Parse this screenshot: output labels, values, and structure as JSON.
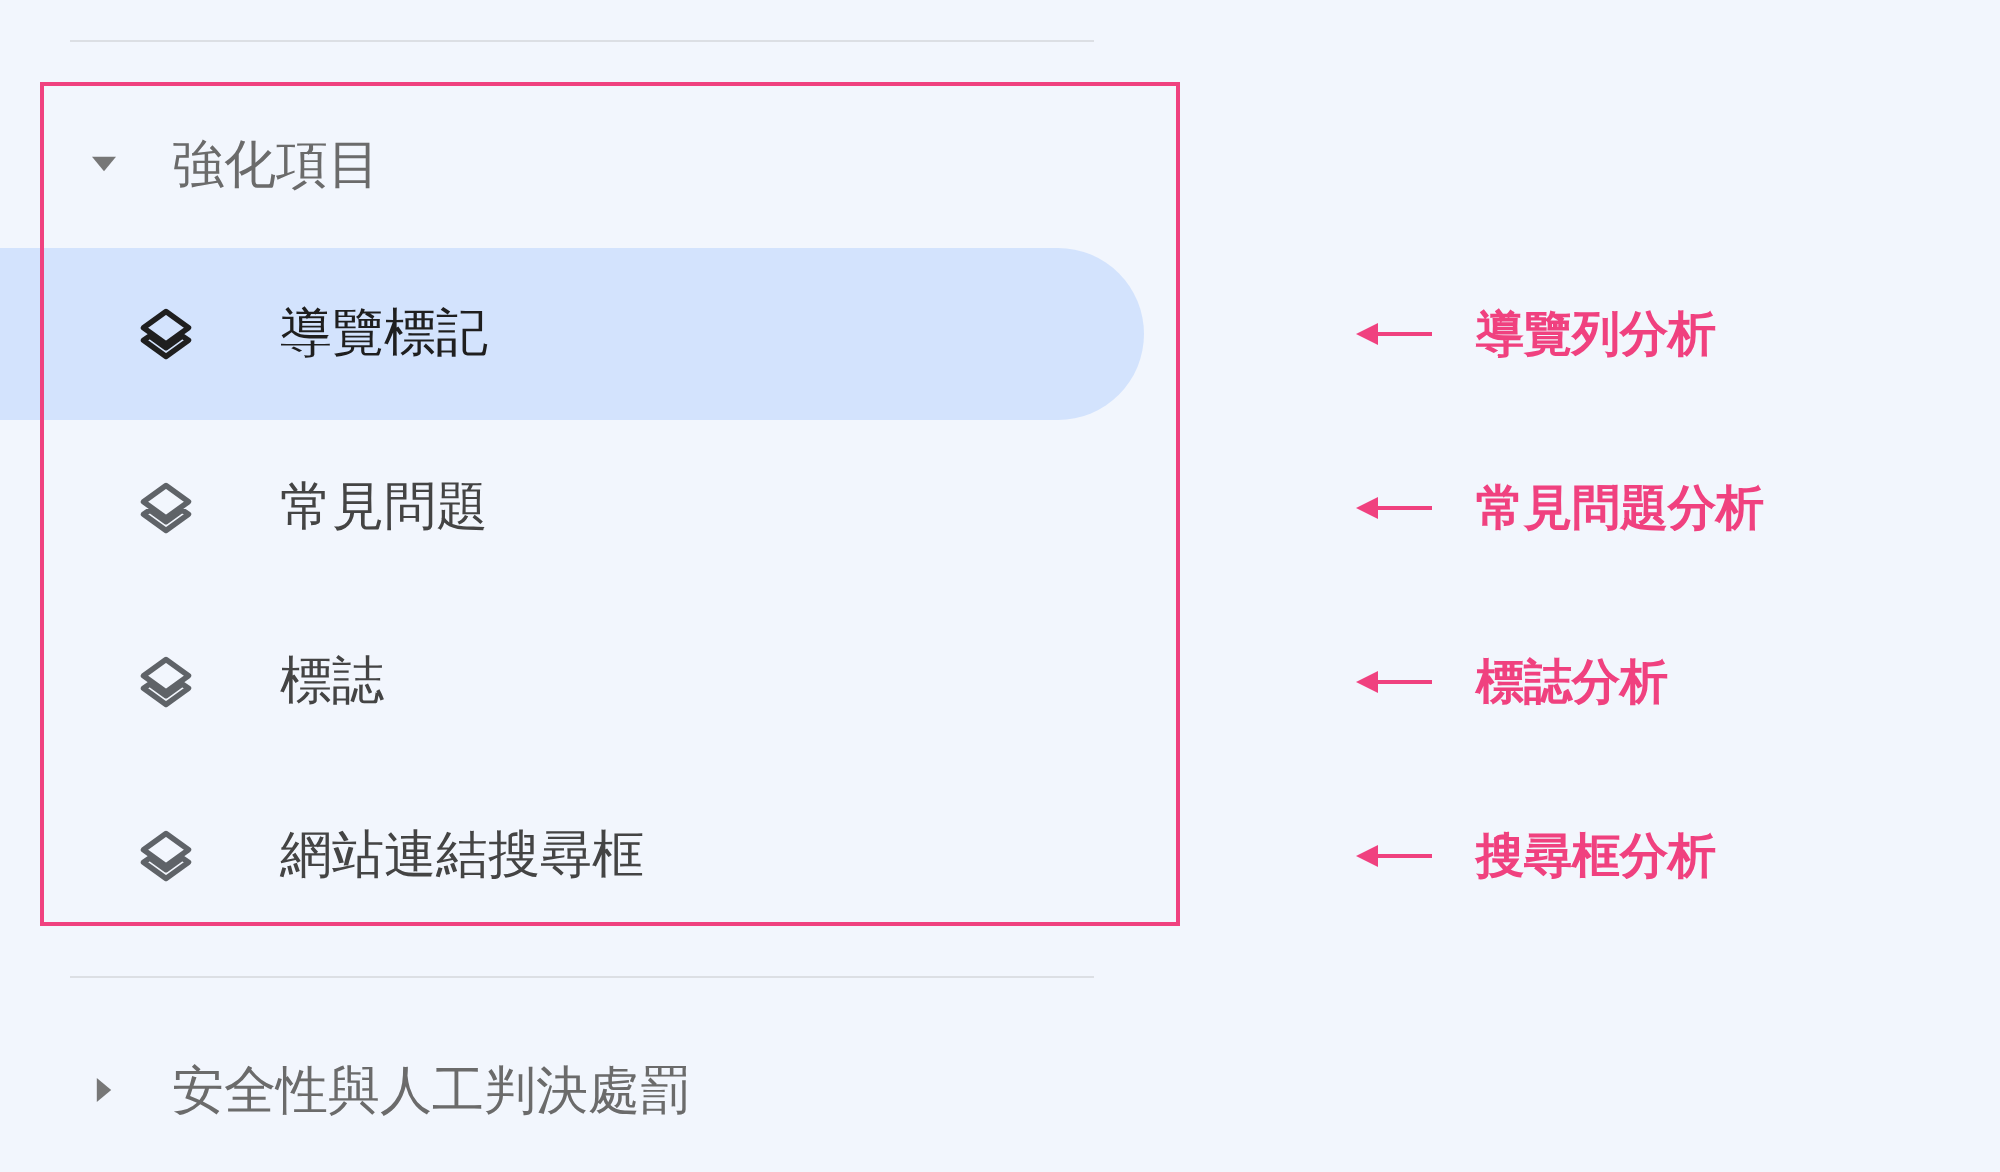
{
  "sidebar": {
    "sections": [
      {
        "title": "強化項目",
        "expanded": true,
        "highlighted": true,
        "items": [
          {
            "label": "導覽標記",
            "selected": true,
            "annotation": "導覽列分析"
          },
          {
            "label": "常見問題",
            "selected": false,
            "annotation": "常見問題分析"
          },
          {
            "label": "標誌",
            "selected": false,
            "annotation": "標誌分析"
          },
          {
            "label": "網站連結搜尋框",
            "selected": false,
            "annotation": "搜尋框分析"
          }
        ]
      },
      {
        "title": "安全性與人工判決處罰",
        "expanded": false
      }
    ]
  }
}
